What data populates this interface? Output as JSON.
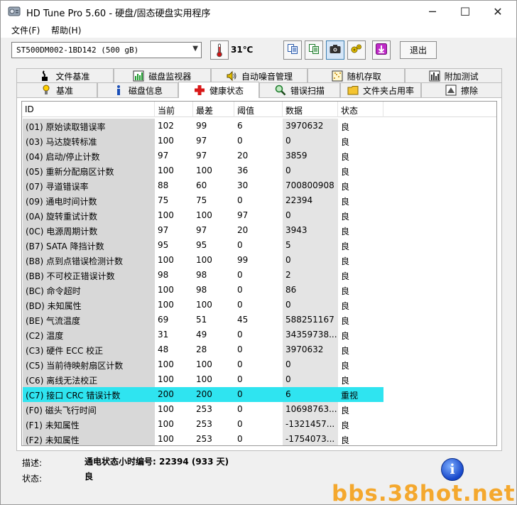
{
  "window": {
    "title": "HD Tune Pro 5.60 - 硬盘/固态硬盘实用程序",
    "min_glyph": "─",
    "max_glyph": "☐",
    "close_glyph": "✕"
  },
  "menu": {
    "file": "文件(F)",
    "help": "帮助(H)"
  },
  "toolbar": {
    "drive": "ST500DM002-1BD142 (500 gB)",
    "temperature": "31℃",
    "exit_label": "退出",
    "icons": [
      "copy-icon",
      "copy-all-icon",
      "camera-icon",
      "options-icon",
      "download-icon"
    ]
  },
  "tabs": {
    "top": [
      {
        "label": "文件基准",
        "icon": "file-benchmark-icon"
      },
      {
        "label": "磁盘监视器",
        "icon": "disk-monitor-icon"
      },
      {
        "label": "自动噪音管理",
        "icon": "speaker-icon"
      },
      {
        "label": "随机存取",
        "icon": "random-access-icon"
      },
      {
        "label": "附加测试",
        "icon": "extra-tests-icon"
      }
    ],
    "bottom": [
      {
        "label": "基准",
        "icon": "benchmark-icon"
      },
      {
        "label": "磁盘信息",
        "icon": "info-icon"
      },
      {
        "label": "健康状态",
        "icon": "health-cross-icon"
      },
      {
        "label": "错误扫描",
        "icon": "magnifier-icon"
      },
      {
        "label": "文件夹占用率",
        "icon": "folder-icon"
      },
      {
        "label": "擦除",
        "icon": "eraser-icon"
      }
    ],
    "active": "健康状态"
  },
  "table": {
    "headers": [
      "ID",
      "当前",
      "最差",
      "阈值",
      "数据",
      "状态"
    ],
    "rows": [
      [
        "(01) 原始读取错误率",
        "102",
        "99",
        "6",
        "3970632",
        "良"
      ],
      [
        "(03) 马达旋转标准",
        "100",
        "97",
        "0",
        "0",
        "良"
      ],
      [
        "(04) 启动/停止计数",
        "97",
        "97",
        "20",
        "3859",
        "良"
      ],
      [
        "(05) 重新分配扇区计数",
        "100",
        "100",
        "36",
        "0",
        "良"
      ],
      [
        "(07) 寻道错误率",
        "88",
        "60",
        "30",
        "700800908",
        "良"
      ],
      [
        "(09) 通电时间计数",
        "75",
        "75",
        "0",
        "22394",
        "良"
      ],
      [
        "(0A) 旋转重试计数",
        "100",
        "100",
        "97",
        "0",
        "良"
      ],
      [
        "(0C) 电源周期计数",
        "97",
        "97",
        "20",
        "3943",
        "良"
      ],
      [
        "(B7) SATA 降挡计数",
        "95",
        "95",
        "0",
        "5",
        "良"
      ],
      [
        "(B8) 点到点错误检测计数",
        "100",
        "100",
        "99",
        "0",
        "良"
      ],
      [
        "(BB) 不可校正错误计数",
        "98",
        "98",
        "0",
        "2",
        "良"
      ],
      [
        "(BC) 命令超时",
        "100",
        "98",
        "0",
        "86",
        "良"
      ],
      [
        "(BD) 未知属性",
        "100",
        "100",
        "0",
        "0",
        "良"
      ],
      [
        "(BE) 气流温度",
        "69",
        "51",
        "45",
        "588251167",
        "良"
      ],
      [
        "(C2) 温度",
        "31",
        "49",
        "0",
        "34359738...",
        "良"
      ],
      [
        "(C3) 硬件 ECC 校正",
        "48",
        "28",
        "0",
        "3970632",
        "良"
      ],
      [
        "(C5) 当前待映射扇区计数",
        "100",
        "100",
        "0",
        "0",
        "良"
      ],
      [
        "(C6) 离线无法校正",
        "100",
        "100",
        "0",
        "0",
        "良"
      ],
      [
        "(C7) 接口 CRC 错误计数",
        "200",
        "200",
        "0",
        "6",
        "重视"
      ],
      [
        "(F0) 磁头飞行时间",
        "100",
        "253",
        "0",
        "10698763...",
        "良"
      ],
      [
        "(F1) 未知属性",
        "100",
        "253",
        "0",
        "-1321457...",
        "良"
      ],
      [
        "(F2) 未知属性",
        "100",
        "253",
        "0",
        "-1754073...",
        "良"
      ]
    ],
    "highlight_row": 18,
    "highlight_color": "#2fe4f0"
  },
  "info": {
    "desc_label": "描述:",
    "desc_value": "通电状态小时编号: 22394 (933 天)",
    "status_label": "状态:",
    "status_value": "良",
    "info_glyph": "i"
  },
  "watermark": "bbs.38hot.net"
}
